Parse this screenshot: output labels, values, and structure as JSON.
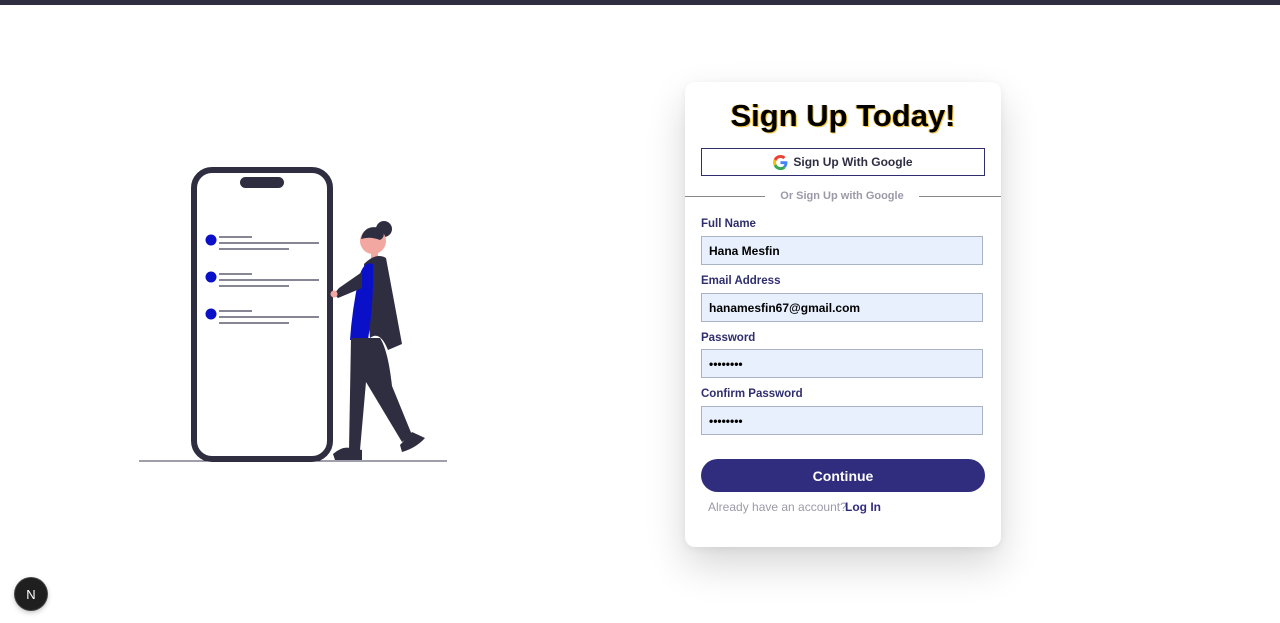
{
  "form": {
    "title": "Sign Up Today!",
    "google_button_label": "Sign Up With Google",
    "divider_text": "Or Sign Up with Google",
    "fields": [
      {
        "label": "Full Name",
        "value": "Hana Mesfin"
      },
      {
        "label": "Email Address",
        "value": "hanamesfin67@gmail.com"
      },
      {
        "label": "Password",
        "value": "••••••••"
      },
      {
        "label": "Confirm Password",
        "value": "••••••••"
      }
    ],
    "continue_label": "Continue",
    "already_text": "Already have an account?",
    "login_label": "Log In"
  },
  "dev_badge": {
    "label": "N"
  },
  "colors": {
    "primary": "#312d7e",
    "input_bg": "#e8f0fe",
    "topbar": "#2f2e41",
    "illustration_accent": "#0a10c8"
  },
  "icons": [
    "google-icon"
  ]
}
